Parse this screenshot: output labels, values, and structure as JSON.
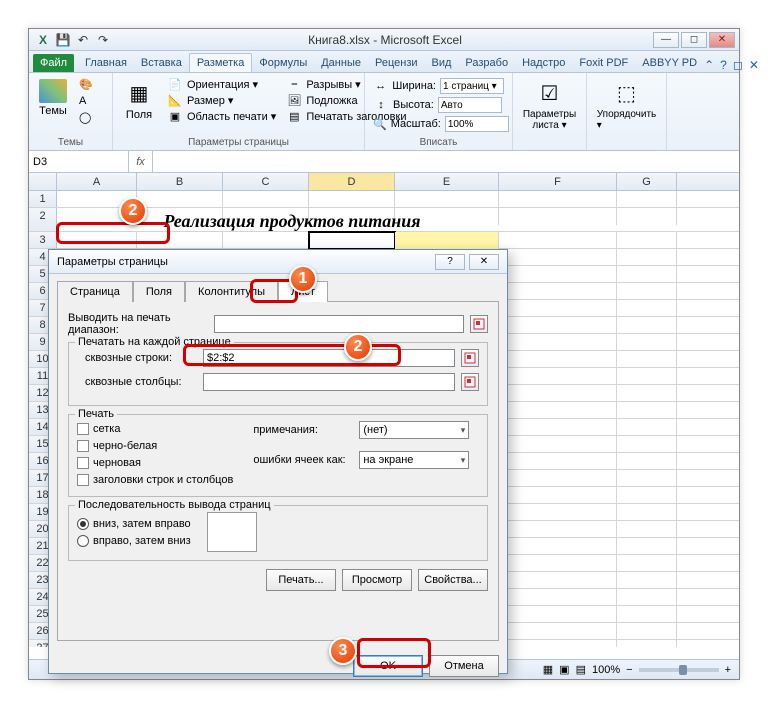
{
  "title": "Книга8.xlsx - Microsoft Excel",
  "tabs": {
    "file": "Файл",
    "t0": "Главная",
    "t1": "Вставка",
    "t2": "Разметка",
    "t3": "Формулы",
    "t4": "Данные",
    "t5": "Рецензи",
    "t6": "Вид",
    "t7": "Разрабо",
    "t8": "Надстро",
    "t9": "Foxit PDF",
    "t10": "ABBYY PD"
  },
  "ribbon": {
    "themes": "Темы",
    "themes_group": "Темы",
    "margins": "Поля",
    "orientation": "Ориентация ▾",
    "size": "Размер ▾",
    "printarea": "Область печати ▾",
    "breaks": "Разрывы ▾",
    "background": "Подложка",
    "printtitles": "Печатать заголовки",
    "pagesetup_group": "Параметры страницы",
    "width": "Ширина:",
    "width_val": "1 страниц ▾",
    "height": "Высота:",
    "height_val": "Авто",
    "scale": "Масштаб:",
    "scale_val": "100%",
    "fit_group": "Вписать",
    "sheetopts": "Параметры листа ▾",
    "arrange": "Упорядочить ▾"
  },
  "namebox": "D3",
  "fx": "fx",
  "cols": [
    "A",
    "B",
    "C",
    "D",
    "E",
    "F",
    "G"
  ],
  "sheet_title": "Реализация продуктов питания",
  "dialog": {
    "title": "Параметры страницы",
    "tab_page": "Страница",
    "tab_margins": "Поля",
    "tab_hf": "Колонтитулы",
    "tab_sheet": "Лист",
    "print_range": "Выводить на печать диапазон:",
    "repeat": "Печатать на каждой странице",
    "rows": "сквозные строки:",
    "rows_val": "$2:$2",
    "cols": "сквозные столбцы:",
    "print": "Печать",
    "grid": "сетка",
    "bw": "черно-белая",
    "draft": "черновая",
    "headings": "заголовки строк и столбцов",
    "comments": "примечания:",
    "comments_val": "(нет)",
    "errors": "ошибки ячеек как:",
    "errors_val": "на экране",
    "order": "Последовательность вывода страниц",
    "down": "вниз, затем вправо",
    "over": "вправо, затем вниз",
    "btn_print": "Печать...",
    "btn_preview": "Просмотр",
    "btn_props": "Свойства...",
    "ok": "OK",
    "cancel": "Отмена"
  },
  "status": {
    "zoom": "100%"
  }
}
